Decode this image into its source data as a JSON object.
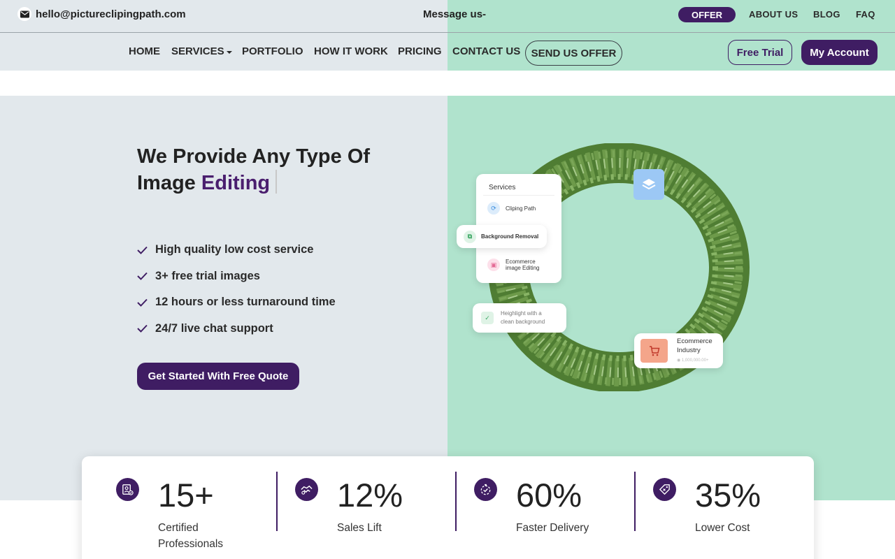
{
  "topbar": {
    "email": "hello@pictureclipingpath.com",
    "message": "Message us-",
    "offer": "OFFER",
    "links": [
      "ABOUT US",
      "BLOG",
      "FAQ"
    ]
  },
  "nav": {
    "items": [
      "HOME",
      "SERVICES",
      "PORTFOLIO",
      "HOW IT WORK",
      "PRICING",
      "CONTACT US"
    ],
    "send_offer": "SEND US OFFER",
    "free_trial": "Free Trial",
    "my_account": "My Account"
  },
  "hero": {
    "title_line1": "We Provide Any Type Of",
    "title_line2_prefix": "Image",
    "title_line2_accent": "Editing",
    "features": [
      "High quality low cost service",
      "3+ free trial images",
      "12 hours or less turnaround time",
      "24/7 live chat support"
    ],
    "cta": "Get Started With Free Quote"
  },
  "illustration": {
    "services_header": "Services",
    "service_1": "Cliping Path",
    "service_2": "Background Removal",
    "service_3_line1": "Ecommerce",
    "service_3_line2": "image Editing",
    "highlight_line1": "Heighlight with a",
    "highlight_line2": "clean background",
    "ecom_line1": "Ecommerce",
    "ecom_line2": "Industry",
    "ecom_sub": "1,000,000.00+"
  },
  "stats": [
    {
      "value": "15+",
      "label": "Certified Professionals",
      "icon": "certificate-icon"
    },
    {
      "value": "12%",
      "label": "Sales Lift",
      "icon": "handshake-icon"
    },
    {
      "value": "60%",
      "label": "Faster Delivery",
      "icon": "stopwatch-icon"
    },
    {
      "value": "35%",
      "label": "Lower Cost",
      "icon": "price-tag-icon"
    }
  ],
  "colors": {
    "brand": "#3f1d63",
    "left_bg": "#e2e8ec",
    "right_bg": "#b0e3cd"
  }
}
